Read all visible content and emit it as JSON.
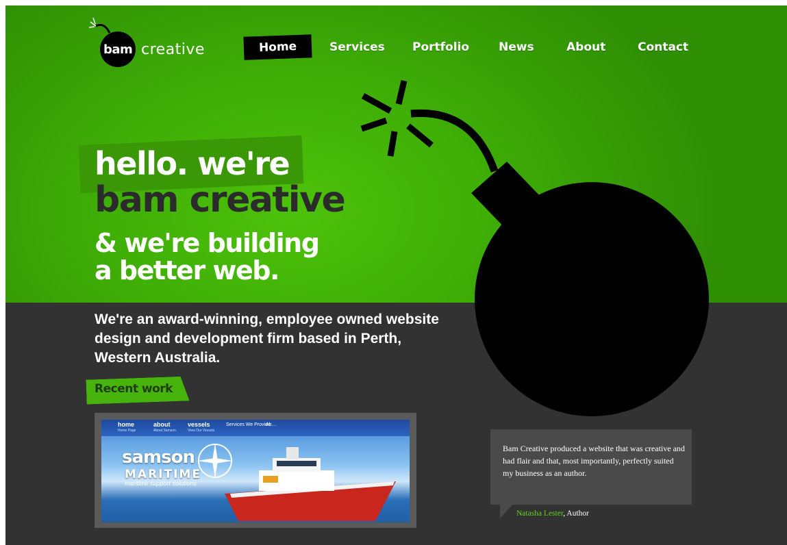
{
  "logo": {
    "bam": "bam",
    "creative": "creative"
  },
  "nav": {
    "items": [
      {
        "label": "Home",
        "active": true
      },
      {
        "label": "Services"
      },
      {
        "label": "Portfolio"
      },
      {
        "label": "News"
      },
      {
        "label": "About"
      },
      {
        "label": "Contact"
      }
    ]
  },
  "hero": {
    "line1": "hello. we're",
    "line2": "bam creative",
    "line3": "& we're building",
    "line4": "a better web."
  },
  "intro": "We're an award-winning, employee owned website design and development firm based in Perth, Western Australia.",
  "recent_work": {
    "label": "Recent work",
    "thumbnail": {
      "nav": [
        {
          "label": "home",
          "sub": "Home Page"
        },
        {
          "label": "about",
          "sub": "About Samson"
        },
        {
          "label": "vessels",
          "sub": "View Our Vessels"
        },
        {
          "label": "Services We Provide",
          "sub": ""
        },
        {
          "label": "Ab…",
          "sub": ""
        }
      ],
      "brand": "samson",
      "maritime": "MARITIME",
      "tagline": "maritime support solutions"
    }
  },
  "testimonial": {
    "quote": "Bam Creative produced a website that was creative and had flair and that, most importantly, perfectly suited my business as an author.",
    "author": "Natasha Lester",
    "role": ", Author"
  },
  "colors": {
    "hero_green": "#46b40c",
    "dark": "#323232",
    "accent_green": "#5fd31a"
  }
}
